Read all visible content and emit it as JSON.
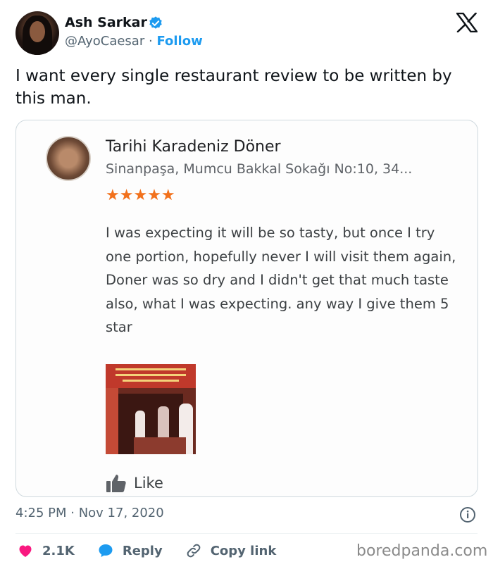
{
  "author": {
    "name": "Ash Sarkar",
    "handle": "@AyoCaesar",
    "separator": "·",
    "follow_label": "Follow"
  },
  "tweet": {
    "text": "I want every single restaurant review to be written by this man."
  },
  "review_card": {
    "place_name": "Tarihi Karadeniz Döner",
    "address": "Sinanpaşa, Mumcu Bakkal Sokağı No:10, 34...",
    "stars": "★★★★★",
    "rating": 5,
    "review_text": "I was expecting it will be so tasty, but once I try one portion, hopefully never I will visit them again, Doner was so dry and I didn't get that much taste also, what I was expecting. any way I give them 5 star",
    "like_label": "Like"
  },
  "meta": {
    "timestamp": "4:25 PM · Nov 17, 2020"
  },
  "actions": {
    "likes_count": "2.1K",
    "reply_label": "Reply",
    "copy_link_label": "Copy link"
  },
  "watermark": "boredpanda.com",
  "colors": {
    "link_blue": "#1d9bf0",
    "heart_red": "#f91880",
    "star_orange": "#f2711c",
    "muted_gray": "#536471"
  },
  "icons": [
    "verified-badge-icon",
    "x-logo-icon",
    "thumbs-up-icon",
    "info-icon",
    "heart-icon",
    "reply-bubble-icon",
    "link-icon"
  ]
}
